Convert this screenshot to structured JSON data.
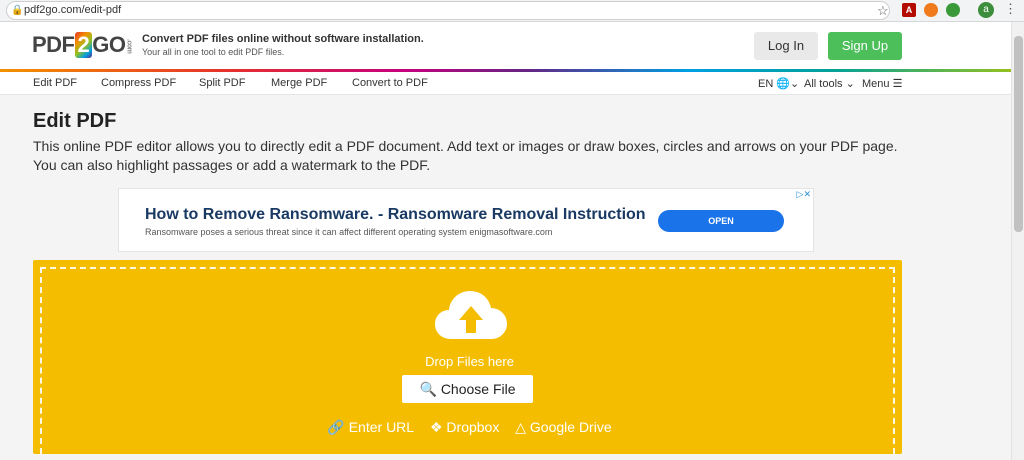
{
  "browser": {
    "url": "pdf2go.com/edit-pdf",
    "avatar_letter": "a",
    "ext_pdf_label": "A"
  },
  "header": {
    "logo": {
      "pdf": "PDF",
      "two": "2",
      "go": "GO",
      "com": ".com"
    },
    "tagline": "Convert PDF files online without software installation.",
    "subtagline": "Your all in one tool to edit PDF files.",
    "login": "Log In",
    "signup": "Sign Up"
  },
  "nav": {
    "items": [
      "Edit PDF",
      "Compress PDF",
      "Split PDF",
      "Merge PDF",
      "Convert to PDF"
    ],
    "language": "EN",
    "all_tools": "All tools",
    "menu": "Menu"
  },
  "main": {
    "title": "Edit PDF",
    "intro": "This online PDF editor allows you to directly edit a PDF document. Add text or images or draw boxes, circles and arrows on your PDF page. You can also highlight passages or add a watermark to the PDF."
  },
  "ad": {
    "title": "How to Remove Ransomware. - Ransomware Removal Instruction",
    "description": "Ransomware poses a serious threat since it can affect different operating system enigmasoftware.com",
    "cta": "OPEN"
  },
  "upload": {
    "drop_text": "Drop Files here",
    "choose_file": "Choose File",
    "enter_url": "Enter URL",
    "dropbox": "Dropbox",
    "google_drive": "Google Drive"
  },
  "colors": {
    "dropzone": "#f5bd00",
    "signup": "#4cbf5b",
    "ad_button": "#1a73e8"
  }
}
